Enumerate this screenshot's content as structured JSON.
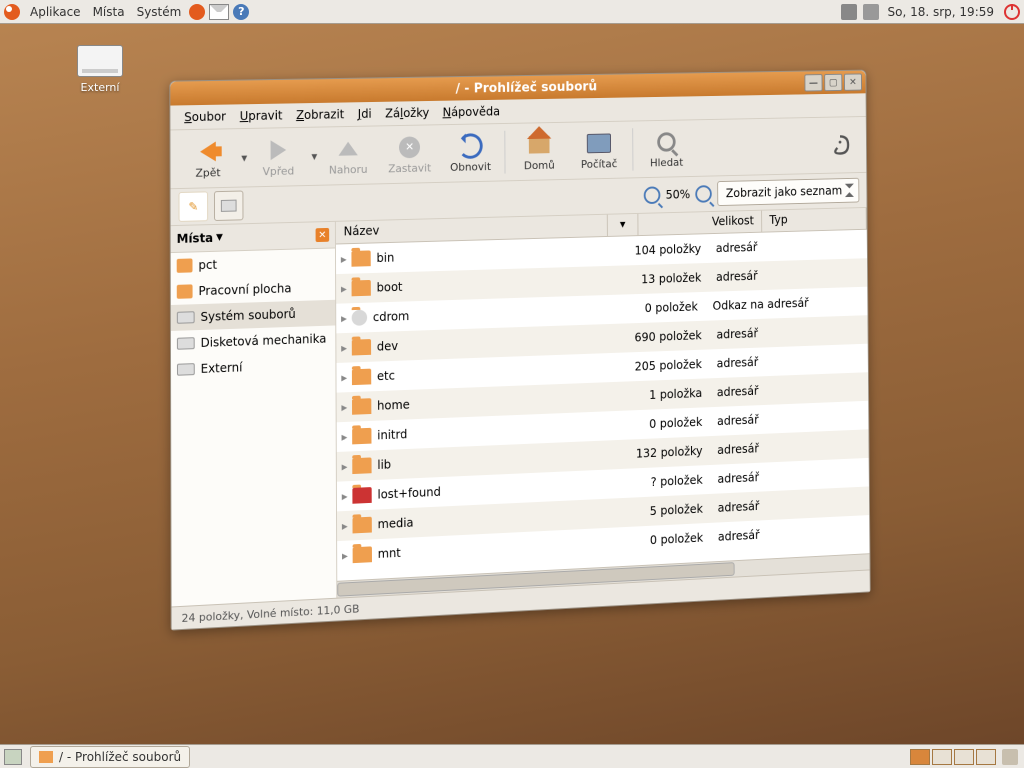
{
  "panel_top": {
    "menu": [
      "Aplikace",
      "Místa",
      "Systém"
    ],
    "clock": "So, 18. srp, 19:59"
  },
  "desktop": {
    "drive_label": "Externí"
  },
  "window": {
    "title": "/ - Prohlížeč souborů",
    "menus": {
      "file": "Soubor",
      "edit": "Upravit",
      "view": "Zobrazit",
      "go": "Jdi",
      "bookmarks": "Záložky",
      "help": "Nápověda"
    },
    "toolbar": {
      "back": "Zpět",
      "forward": "Vpřed",
      "up": "Nahoru",
      "stop": "Zastavit",
      "reload": "Obnovit",
      "home": "Domů",
      "computer": "Počítač",
      "search": "Hledat"
    },
    "zoom_pct": "50%",
    "view_mode": "Zobrazit jako seznam",
    "sidebar_title": "Místa",
    "places": [
      {
        "name": "pct",
        "icon": "folder"
      },
      {
        "name": "Pracovní plocha",
        "icon": "folder"
      },
      {
        "name": "Systém souborů",
        "icon": "drive",
        "selected": true
      },
      {
        "name": "Disketová mechanika",
        "icon": "drive"
      },
      {
        "name": "Externí",
        "icon": "drive"
      }
    ],
    "columns": {
      "name": "Název",
      "size": "Velikost",
      "type": "Typ"
    },
    "rows": [
      {
        "name": "bin",
        "size": "104 položky",
        "type": "adresář",
        "icon": "folder"
      },
      {
        "name": "boot",
        "size": "13 položek",
        "type": "adresář",
        "icon": "folder"
      },
      {
        "name": "cdrom",
        "size": "0 položek",
        "type": "Odkaz na adresář",
        "icon": "cd"
      },
      {
        "name": "dev",
        "size": "690 položek",
        "type": "adresář",
        "icon": "folder"
      },
      {
        "name": "etc",
        "size": "205 položek",
        "type": "adresář",
        "icon": "folder"
      },
      {
        "name": "home",
        "size": "1 položka",
        "type": "adresář",
        "icon": "folder"
      },
      {
        "name": "initrd",
        "size": "0 položek",
        "type": "adresář",
        "icon": "folder"
      },
      {
        "name": "lib",
        "size": "132 položky",
        "type": "adresář",
        "icon": "folder"
      },
      {
        "name": "lost+found",
        "size": "? položek",
        "type": "adresář",
        "icon": "bad"
      },
      {
        "name": "media",
        "size": "5 položek",
        "type": "adresář",
        "icon": "folder"
      },
      {
        "name": "mnt",
        "size": "0 položek",
        "type": "adresář",
        "icon": "folder"
      }
    ],
    "status": "24 položky, Volné místo: 11,0 GB"
  },
  "panel_bottom": {
    "task": "/ - Prohlížeč souborů"
  }
}
